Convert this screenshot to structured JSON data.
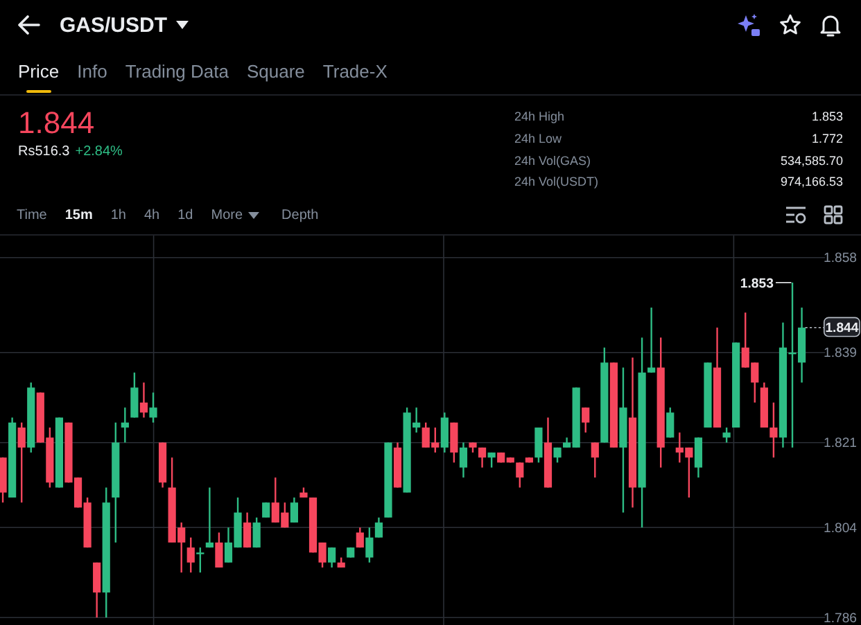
{
  "header": {
    "title": "GAS/USDT"
  },
  "tabs": [
    {
      "label": "Price",
      "selected": true
    },
    {
      "label": "Info",
      "selected": false
    },
    {
      "label": "Trading Data",
      "selected": false
    },
    {
      "label": "Square",
      "selected": false
    },
    {
      "label": "Trade-X",
      "selected": false
    }
  ],
  "price": {
    "last": "1.844",
    "fiat": "Rs516.3",
    "change": "+2.84%"
  },
  "stats": [
    {
      "label": "24h High",
      "value": "1.853"
    },
    {
      "label": "24h Low",
      "value": "1.772"
    },
    {
      "label": "24h Vol(GAS)",
      "value": "534,585.70"
    },
    {
      "label": "24h Vol(USDT)",
      "value": "974,166.53"
    }
  ],
  "intervals": [
    {
      "label": "Time",
      "kind": "interval",
      "selected": false
    },
    {
      "label": "15m",
      "kind": "interval",
      "selected": true
    },
    {
      "label": "1h",
      "kind": "interval",
      "selected": false
    },
    {
      "label": "4h",
      "kind": "interval",
      "selected": false
    },
    {
      "label": "1d",
      "kind": "interval",
      "selected": false
    },
    {
      "label": "More",
      "kind": "dropdown",
      "selected": false
    },
    {
      "label": "Depth",
      "kind": "view",
      "selected": false
    }
  ],
  "chart": {
    "chart_data": {
      "type": "candlestick",
      "categories": [
        null,
        null,
        null,
        null,
        null,
        null,
        null,
        null,
        null,
        null,
        null,
        null,
        null,
        null,
        null,
        null,
        null,
        null,
        null,
        null,
        null,
        null,
        null,
        null,
        null,
        null,
        null,
        null,
        null,
        null,
        null,
        null,
        null,
        null,
        null,
        null,
        null,
        null,
        null,
        null,
        null,
        null,
        null,
        null,
        null,
        null,
        null,
        null,
        null,
        null,
        null,
        null,
        null,
        null,
        null,
        null,
        null,
        null,
        null,
        null,
        null,
        null,
        null,
        null,
        null,
        null,
        null,
        null,
        null,
        null,
        null,
        null,
        null,
        null,
        null,
        null,
        null,
        null,
        null,
        null,
        null,
        null,
        null,
        null,
        null,
        null
      ],
      "ohlc": [
        [
          1.818,
          1.818,
          1.809,
          1.811
        ],
        [
          1.81,
          1.826,
          1.81,
          1.825
        ],
        [
          1.824,
          1.825,
          1.809,
          1.82
        ],
        [
          1.82,
          1.833,
          1.819,
          1.832
        ],
        [
          1.831,
          1.831,
          1.821,
          1.821
        ],
        [
          1.822,
          1.824,
          1.812,
          1.813
        ],
        [
          1.812,
          1.826,
          1.812,
          1.826
        ],
        [
          1.825,
          1.825,
          1.813,
          1.813
        ],
        [
          1.814,
          1.814,
          1.808,
          1.808
        ],
        [
          1.809,
          1.81,
          1.8,
          1.8
        ],
        [
          1.797,
          1.797,
          1.786,
          1.791
        ],
        [
          1.791,
          1.812,
          1.786,
          1.809
        ],
        [
          1.81,
          1.825,
          1.801,
          1.821
        ],
        [
          1.824,
          1.828,
          1.821,
          1.825
        ],
        [
          1.826,
          1.835,
          1.826,
          1.832
        ],
        [
          1.829,
          1.833,
          1.826,
          1.827
        ],
        [
          1.826,
          1.831,
          1.825,
          1.828
        ],
        [
          1.821,
          1.821,
          1.812,
          1.813
        ],
        [
          1.812,
          1.818,
          1.801,
          1.801
        ],
        [
          1.804,
          1.805,
          1.795,
          1.801
        ],
        [
          1.8,
          1.802,
          1.795,
          1.797
        ],
        [
          1.799,
          1.8,
          1.795,
          1.799
        ],
        [
          1.8,
          1.812,
          1.8,
          1.801
        ],
        [
          1.801,
          1.803,
          1.796,
          1.796
        ],
        [
          1.797,
          1.804,
          1.797,
          1.801
        ],
        [
          1.8,
          1.81,
          1.8,
          1.807
        ],
        [
          1.805,
          1.807,
          1.8,
          1.8
        ],
        [
          1.8,
          1.806,
          1.8,
          1.805
        ],
        [
          1.806,
          1.809,
          1.806,
          1.809
        ],
        [
          1.809,
          1.814,
          1.805,
          1.805
        ],
        [
          1.807,
          1.809,
          1.804,
          1.804
        ],
        [
          1.805,
          1.81,
          1.805,
          1.809
        ],
        [
          1.811,
          1.812,
          1.81,
          1.81
        ],
        [
          1.81,
          1.81,
          1.799,
          1.799
        ],
        [
          1.801,
          1.801,
          1.796,
          1.797
        ],
        [
          1.797,
          1.8,
          1.796,
          1.8
        ],
        [
          1.797,
          1.798,
          1.796,
          1.796
        ],
        [
          1.798,
          1.8,
          1.798,
          1.8
        ],
        [
          1.803,
          1.804,
          1.8,
          1.8
        ],
        [
          1.798,
          1.804,
          1.797,
          1.802
        ],
        [
          1.802,
          1.806,
          1.802,
          1.805
        ],
        [
          1.806,
          1.821,
          1.806,
          1.821
        ],
        [
          1.82,
          1.821,
          1.812,
          1.812
        ],
        [
          1.811,
          1.828,
          1.811,
          1.827
        ],
        [
          1.824,
          1.828,
          1.823,
          1.825
        ],
        [
          1.824,
          1.825,
          1.82,
          1.82
        ],
        [
          1.821,
          1.824,
          1.819,
          1.82
        ],
        [
          1.82,
          1.827,
          1.819,
          1.826
        ],
        [
          1.825,
          1.825,
          1.817,
          1.819
        ],
        [
          1.816,
          1.821,
          1.814,
          1.82
        ],
        [
          1.821,
          1.821,
          1.819,
          1.82
        ],
        [
          1.82,
          1.82,
          1.816,
          1.818
        ],
        [
          1.818,
          1.819,
          1.816,
          1.819
        ],
        [
          1.819,
          1.819,
          1.817,
          1.817
        ],
        [
          1.818,
          1.818,
          1.817,
          1.817
        ],
        [
          1.817,
          1.817,
          1.812,
          1.814
        ],
        [
          1.818,
          1.818,
          1.817,
          1.817
        ],
        [
          1.818,
          1.824,
          1.817,
          1.824
        ],
        [
          1.821,
          1.826,
          1.812,
          1.812
        ],
        [
          1.818,
          1.82,
          1.817,
          1.82
        ],
        [
          1.82,
          1.822,
          1.82,
          1.821
        ],
        [
          1.82,
          1.832,
          1.82,
          1.832
        ],
        [
          1.828,
          1.828,
          1.823,
          1.825
        ],
        [
          1.821,
          1.821,
          1.814,
          1.818
        ],
        [
          1.821,
          1.84,
          1.821,
          1.837
        ],
        [
          1.837,
          1.837,
          1.82,
          1.82
        ],
        [
          1.82,
          1.836,
          1.807,
          1.828
        ],
        [
          1.826,
          1.838,
          1.808,
          1.812
        ],
        [
          1.812,
          1.842,
          1.804,
          1.835
        ],
        [
          1.835,
          1.848,
          1.835,
          1.836
        ],
        [
          1.836,
          1.842,
          1.816,
          1.82
        ],
        [
          1.822,
          1.828,
          1.822,
          1.827
        ],
        [
          1.82,
          1.823,
          1.817,
          1.819
        ],
        [
          1.82,
          1.82,
          1.81,
          1.818
        ],
        [
          1.816,
          1.822,
          1.814,
          1.822
        ],
        [
          1.824,
          1.837,
          1.824,
          1.837
        ],
        [
          1.836,
          1.844,
          1.824,
          1.824
        ],
        [
          1.822,
          1.824,
          1.821,
          1.823
        ],
        [
          1.824,
          1.841,
          1.824,
          1.841
        ],
        [
          1.84,
          1.847,
          1.836,
          1.836
        ],
        [
          1.837,
          1.837,
          1.829,
          1.833
        ],
        [
          1.832,
          1.833,
          1.824,
          1.824
        ],
        [
          1.824,
          1.829,
          1.818,
          1.822
        ],
        [
          1.822,
          1.845,
          1.82,
          1.84
        ],
        [
          1.839,
          1.853,
          1.82,
          1.839
        ],
        [
          1.837,
          1.848,
          1.833,
          1.844
        ]
      ],
      "ylim": [
        1.7845,
        1.8624
      ],
      "yticks": [
        1.858,
        1.839,
        1.821,
        1.804,
        1.786
      ],
      "grid": true,
      "annotations": [
        "1.853",
        "1.844"
      ]
    }
  }
}
